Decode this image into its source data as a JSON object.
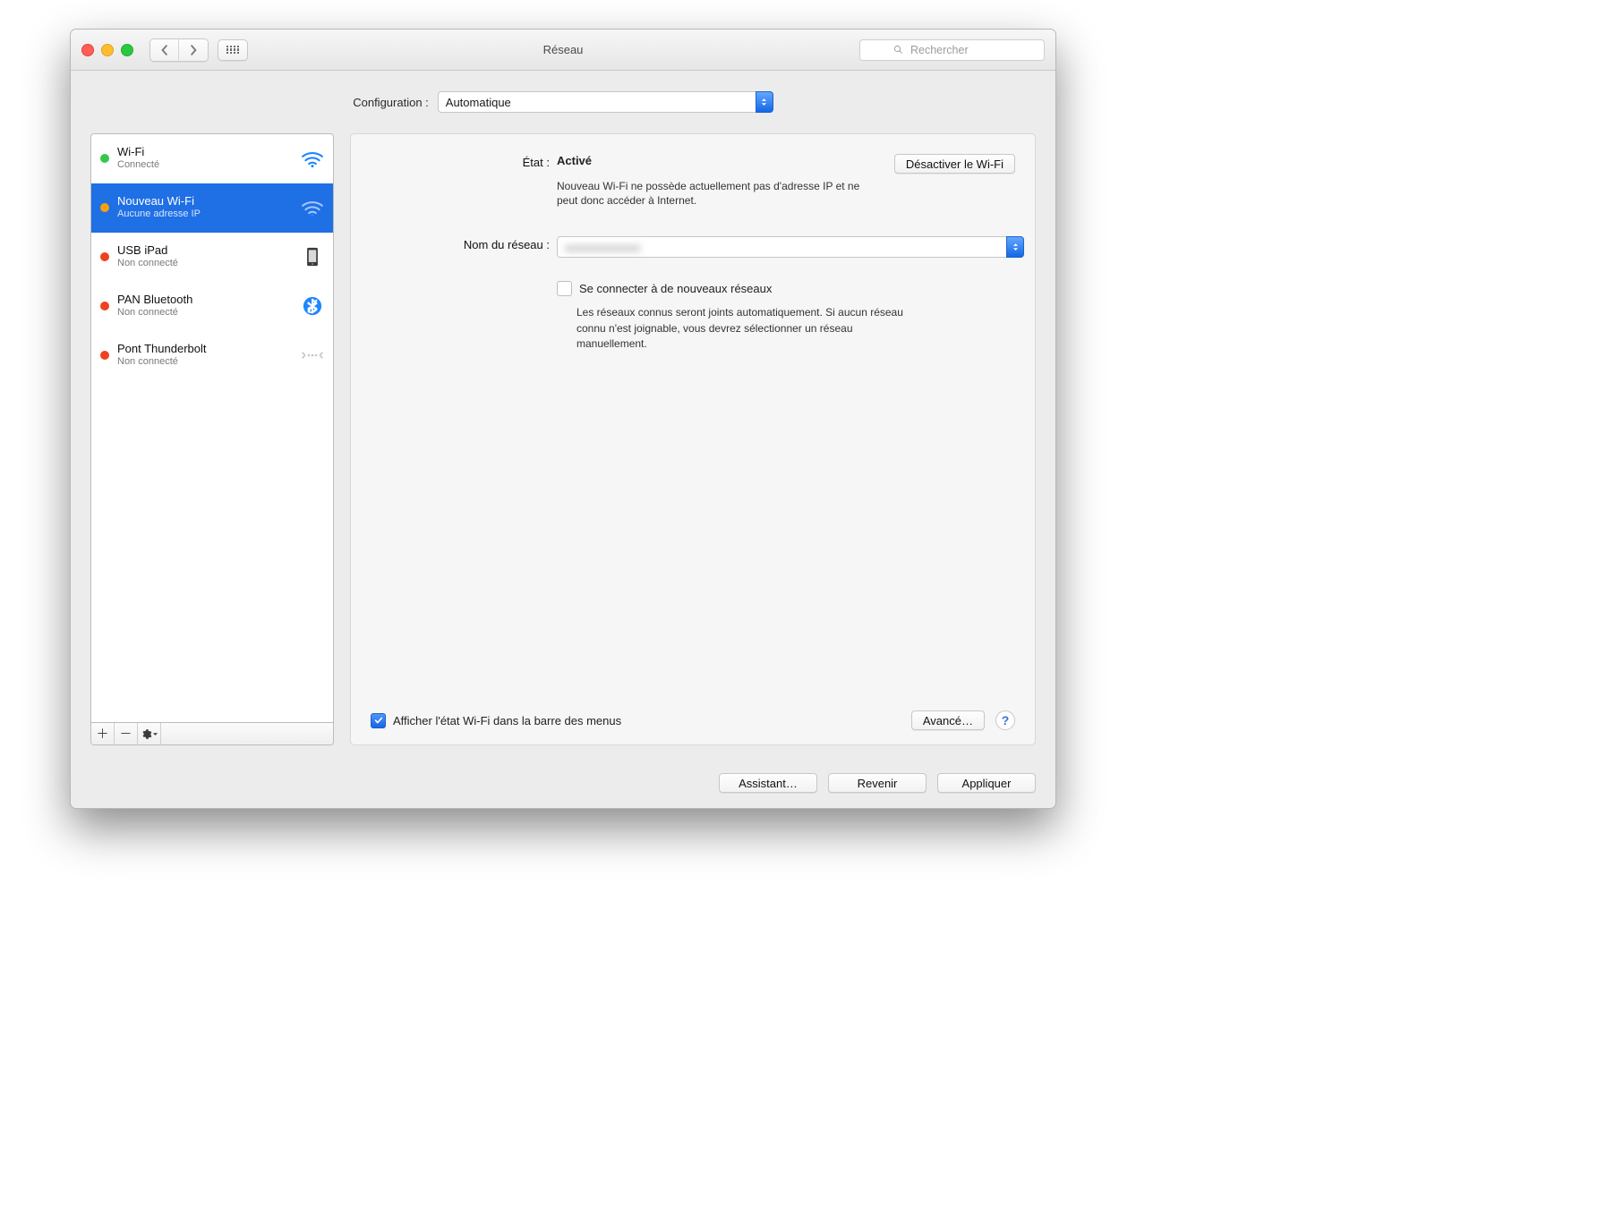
{
  "window": {
    "title": "Réseau"
  },
  "toolbar": {
    "search_placeholder": "Rechercher"
  },
  "config": {
    "label": "Configuration :",
    "value": "Automatique"
  },
  "sidebar": {
    "services": [
      {
        "name": "Wi-Fi",
        "sub": "Connecté",
        "status": "green",
        "icon": "wifi",
        "selected": false
      },
      {
        "name": "Nouveau Wi-Fi",
        "sub": "Aucune adresse IP",
        "status": "orange",
        "icon": "wifi",
        "selected": true
      },
      {
        "name": "USB iPad",
        "sub": "Non connecté",
        "status": "red",
        "icon": "ipad",
        "selected": false
      },
      {
        "name": "PAN Bluetooth",
        "sub": "Non connecté",
        "status": "red",
        "icon": "bluetooth",
        "selected": false
      },
      {
        "name": "Pont Thunderbolt",
        "sub": "Non connecté",
        "status": "red",
        "icon": "thunderbolt",
        "selected": false
      }
    ]
  },
  "detail": {
    "status_label": "État :",
    "status_value": "Activé",
    "toggle_button": "Désactiver le Wi-Fi",
    "status_note": "Nouveau Wi-Fi ne possède actuellement pas d'adresse IP et ne peut donc accéder à Internet.",
    "network_label": "Nom du réseau :",
    "network_value": "",
    "join_new": {
      "checked": false,
      "label": "Se connecter à de nouveaux réseaux",
      "hint": "Les réseaux connus seront joints automatiquement. Si aucun réseau connu n'est joignable, vous devrez sélectionner un réseau manuellement."
    },
    "show_in_menu": {
      "checked": true,
      "label": "Afficher l'état Wi-Fi dans la barre des menus"
    },
    "advanced": "Avancé…"
  },
  "footer": {
    "assistant": "Assistant…",
    "revert": "Revenir",
    "apply": "Appliquer"
  },
  "colors": {
    "accent": "#1f6fe5",
    "green": "#34c84a",
    "orange": "#f8a10b",
    "red": "#ee411d"
  }
}
